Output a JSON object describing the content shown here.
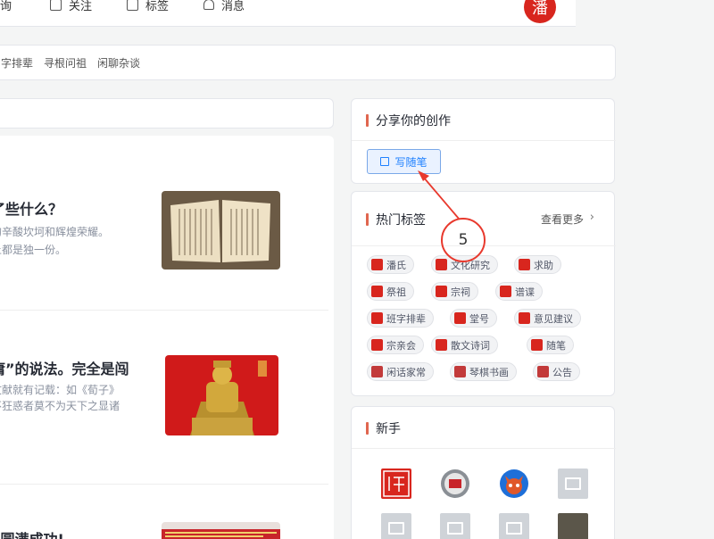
{
  "nav": {
    "search": "询",
    "follow": "关注",
    "tags": "标签",
    "messages": "消息",
    "logo_char": "潘"
  },
  "categories": [
    "字排辈",
    "寻根问祖",
    "闲聊杂谈"
  ],
  "feed": {
    "articles": [
      {
        "title": "了些什么？",
        "lines": [
          "的辛酸坎坷和辉煌荣耀。",
          "上都是独一份。"
        ]
      },
      {
        "title": "庸”的说法。完全是闯",
        "lines": [
          "文献就有记载：如《荀子》",
          "不狂惑者莫不为天下之显诸"
        ]
      },
      {
        "title": "”圆满成功!",
        "lines": []
      }
    ]
  },
  "share": {
    "title": "分享你的创作",
    "write_label": "写随笔"
  },
  "hot_tags": {
    "title": "热门标签",
    "more": "查看更多",
    "tags": [
      "潘氏",
      "文化研究",
      "求助",
      "祭祖",
      "宗祠",
      "谱谍",
      "班字排辈",
      "堂号",
      "意见建议",
      "宗亲会",
      "散文诗词",
      "随笔",
      "闲话家常",
      "琴棋书画",
      "公告"
    ]
  },
  "newbies": {
    "title": "新手"
  },
  "annotation": {
    "step": "5"
  },
  "colors": {
    "accent": "#1e80ff",
    "brand_red": "#d8261e",
    "heading_bar": "#e0664f",
    "annotation": "#e8392d"
  }
}
